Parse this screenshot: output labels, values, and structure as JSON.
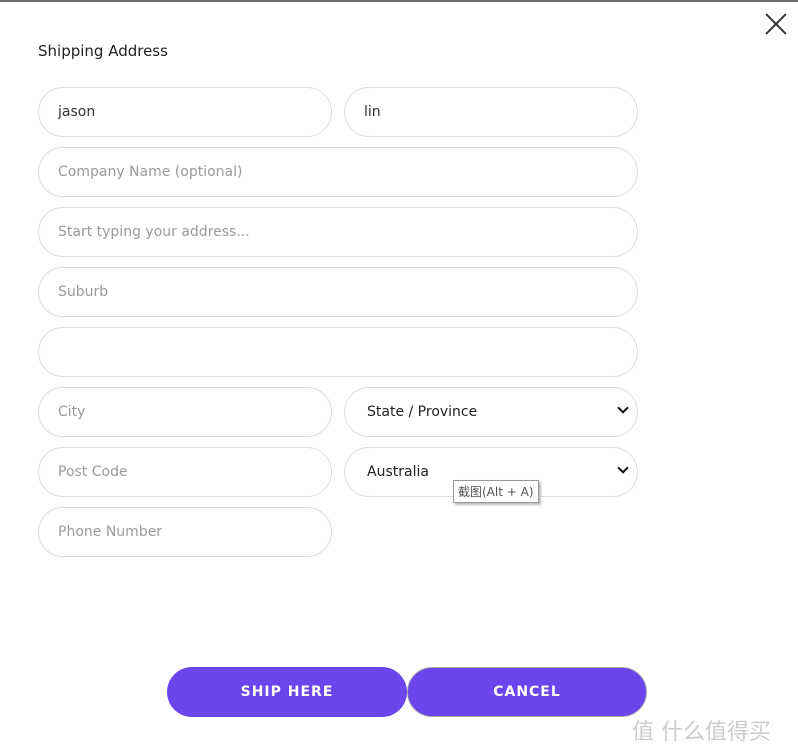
{
  "title": "Shipping Address",
  "fields": {
    "first_name": "jason",
    "last_name": "lin",
    "company_placeholder": "Company Name (optional)",
    "address_placeholder": "Start typing your address...",
    "suburb_placeholder": "Suburb",
    "extra_value": "",
    "city_placeholder": "City",
    "state_selected": "State / Province",
    "postcode_placeholder": "Post Code",
    "country_selected": "Australia",
    "phone_placeholder": "Phone Number"
  },
  "tooltip": "截图(Alt + A)",
  "buttons": {
    "ship": "SHIP HERE",
    "cancel": "CANCEL"
  },
  "watermark": "值 什么值得买",
  "colors": {
    "accent": "#6a45ec"
  }
}
